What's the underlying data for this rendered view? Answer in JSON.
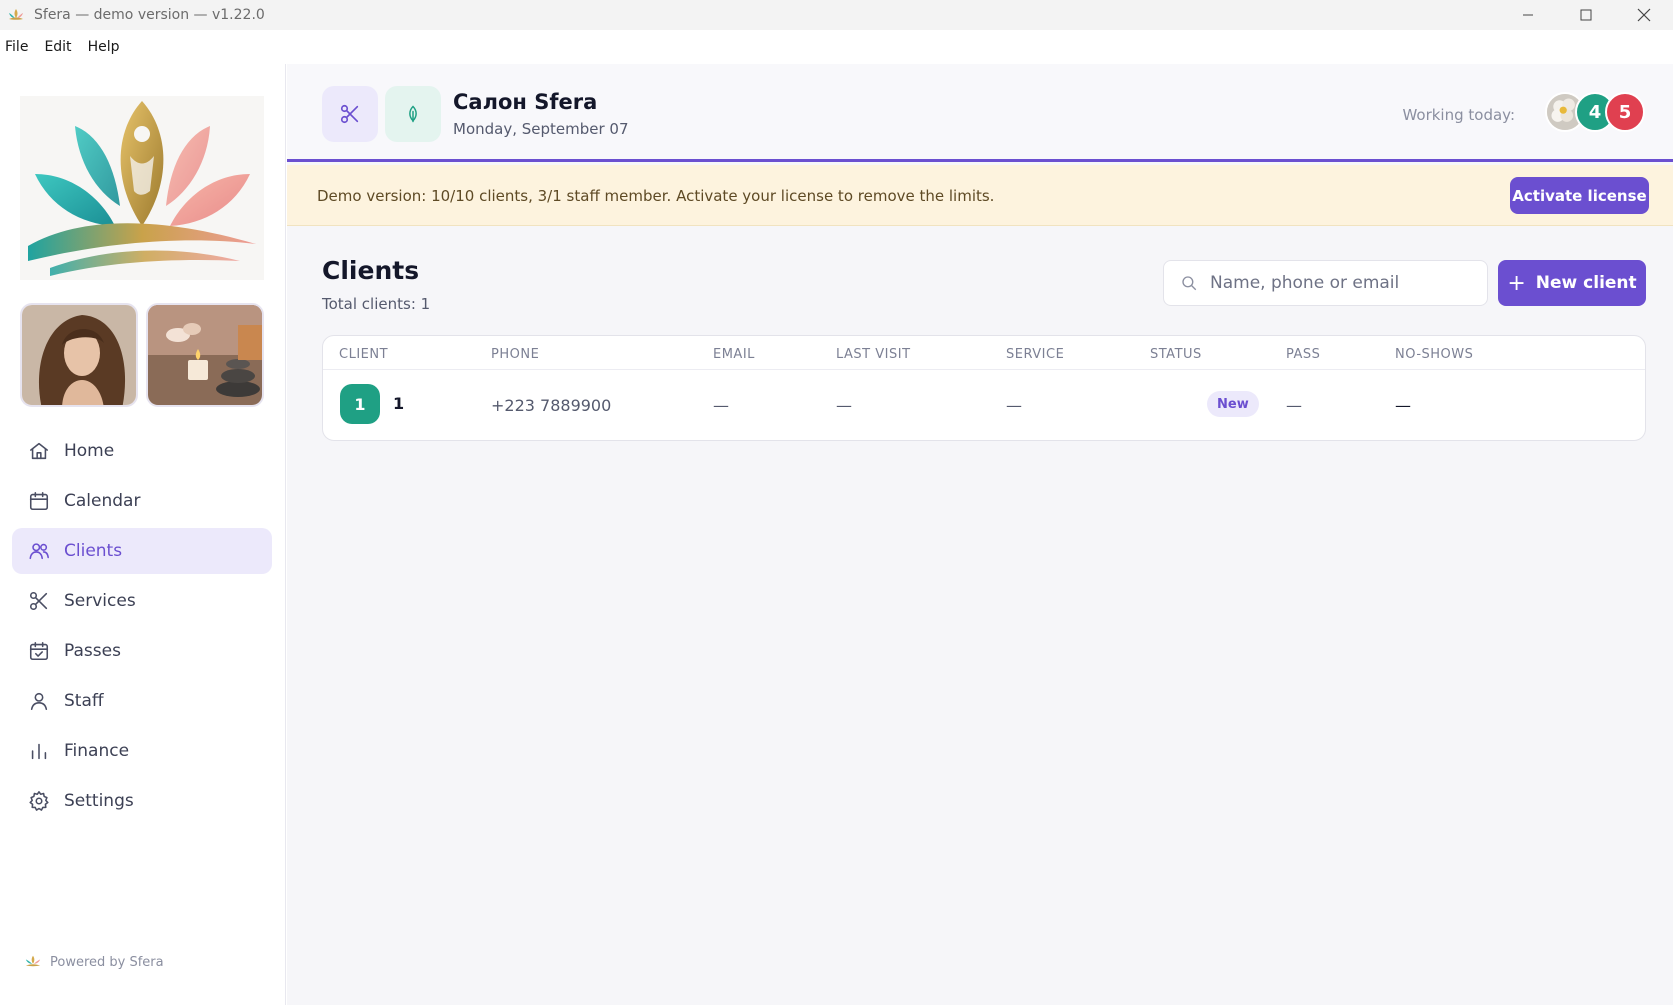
{
  "window": {
    "title": "Sfera — demo version — v1.22.0"
  },
  "menubar": {
    "items": [
      "File",
      "Edit",
      "Help"
    ]
  },
  "sidebar": {
    "items": [
      {
        "label": "Home",
        "icon": "home-icon"
      },
      {
        "label": "Calendar",
        "icon": "calendar-icon"
      },
      {
        "label": "Clients",
        "icon": "users-icon",
        "active": true
      },
      {
        "label": "Services",
        "icon": "scissors-icon"
      },
      {
        "label": "Passes",
        "icon": "calendar-check-icon"
      },
      {
        "label": "Staff",
        "icon": "user-icon"
      },
      {
        "label": "Finance",
        "icon": "bar-chart-icon"
      },
      {
        "label": "Settings",
        "icon": "gear-icon"
      }
    ],
    "powered_by": "Powered by Sfera"
  },
  "header": {
    "salon_name": "Салон Sfera",
    "date": "Monday, September 07",
    "working_today_label": "Working today:",
    "staff_avatars": [
      "",
      "4",
      "5"
    ]
  },
  "demo_banner": {
    "text": "Demo version: 10/10 clients, 3/1 staff member. Activate your license to remove the limits.",
    "button_label": "Activate license"
  },
  "clients": {
    "title": "Clients",
    "total": "Total clients: 1",
    "search_placeholder": "Name, phone or email",
    "new_button": "New client",
    "columns": [
      "CLIENT",
      "PHONE",
      "EMAIL",
      "LAST VISIT",
      "SERVICE",
      "STATUS",
      "PASS",
      "NO-SHOWS"
    ],
    "rows": [
      {
        "badge": "1",
        "name": "1",
        "phone": "+223 7889900",
        "email": "—",
        "last_visit": "—",
        "service": "—",
        "status": "New",
        "pass": "—",
        "no_shows": "—"
      }
    ]
  },
  "colors": {
    "accent": "#6b4fd0",
    "teal": "#1fa084",
    "red": "#e04050",
    "banner_bg": "#fdf3de"
  }
}
